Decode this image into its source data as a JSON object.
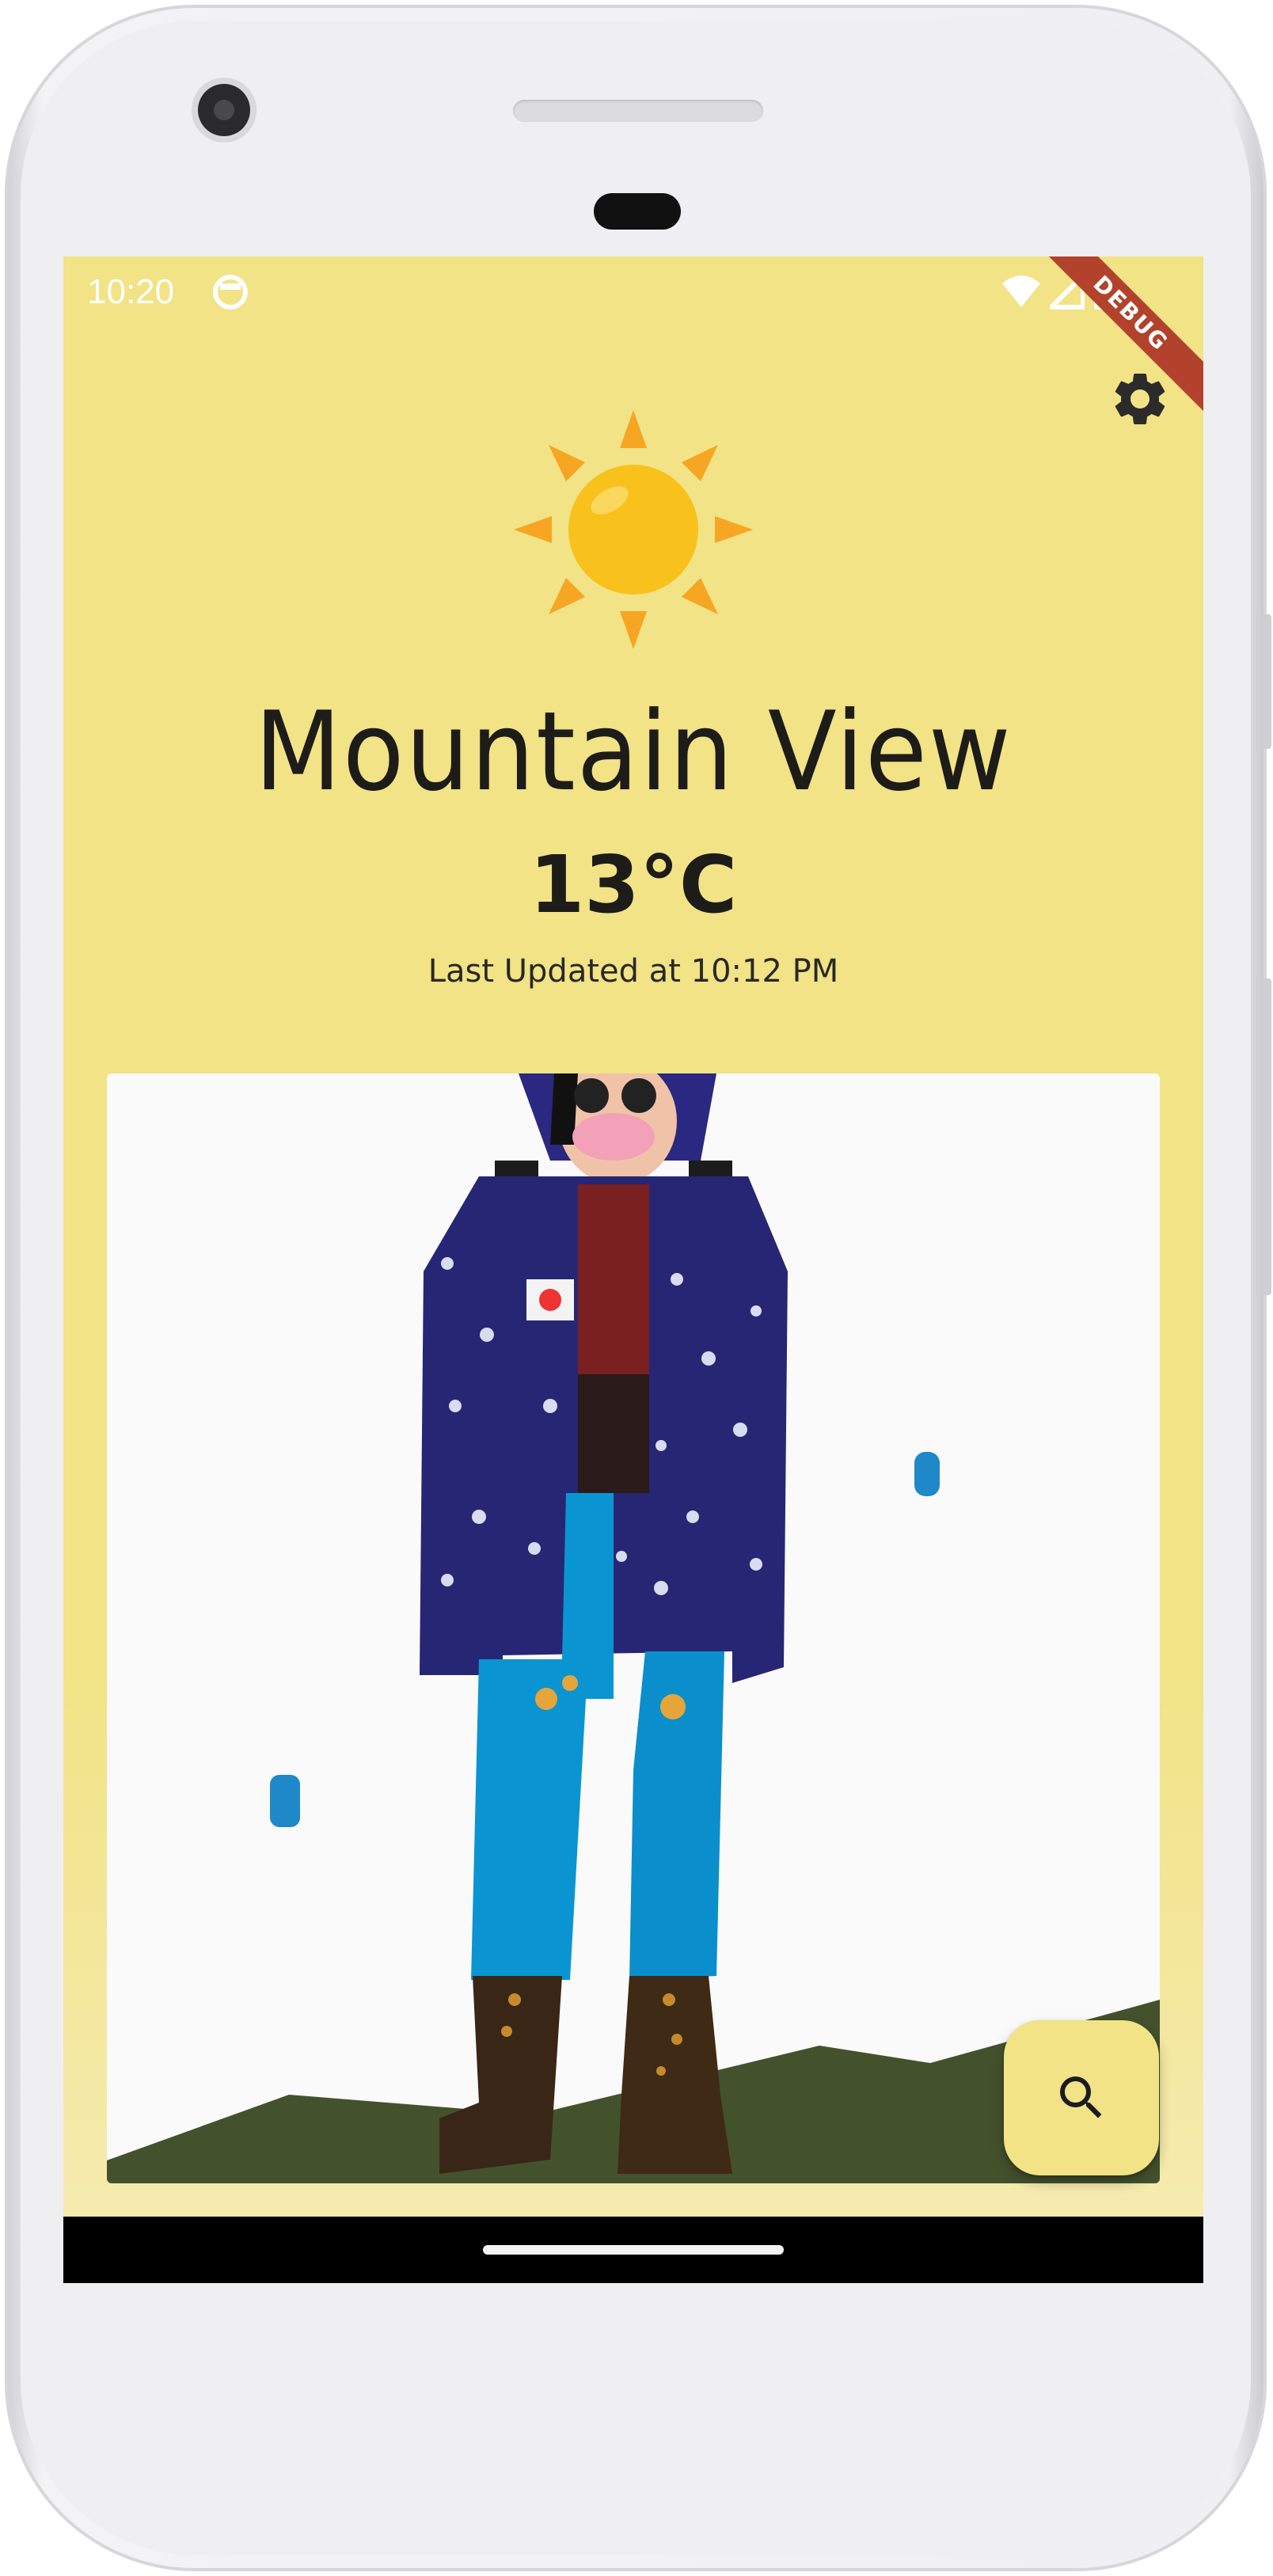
{
  "status_bar": {
    "time": "10:20",
    "debug_label": "DEBUG"
  },
  "weather": {
    "city": "Mountain View",
    "temperature": "13°C",
    "last_updated": "Last Updated at 10:12 PM",
    "condition_icon": "sun-icon"
  },
  "actions": {
    "settings_icon": "gear-icon",
    "search_icon": "search-icon"
  },
  "colors": {
    "background": "#f1e386",
    "text": "#1e1c18",
    "debug_ribbon": "#b3422c",
    "sun": "#f9c11c",
    "sun_rays": "#f6a623"
  }
}
